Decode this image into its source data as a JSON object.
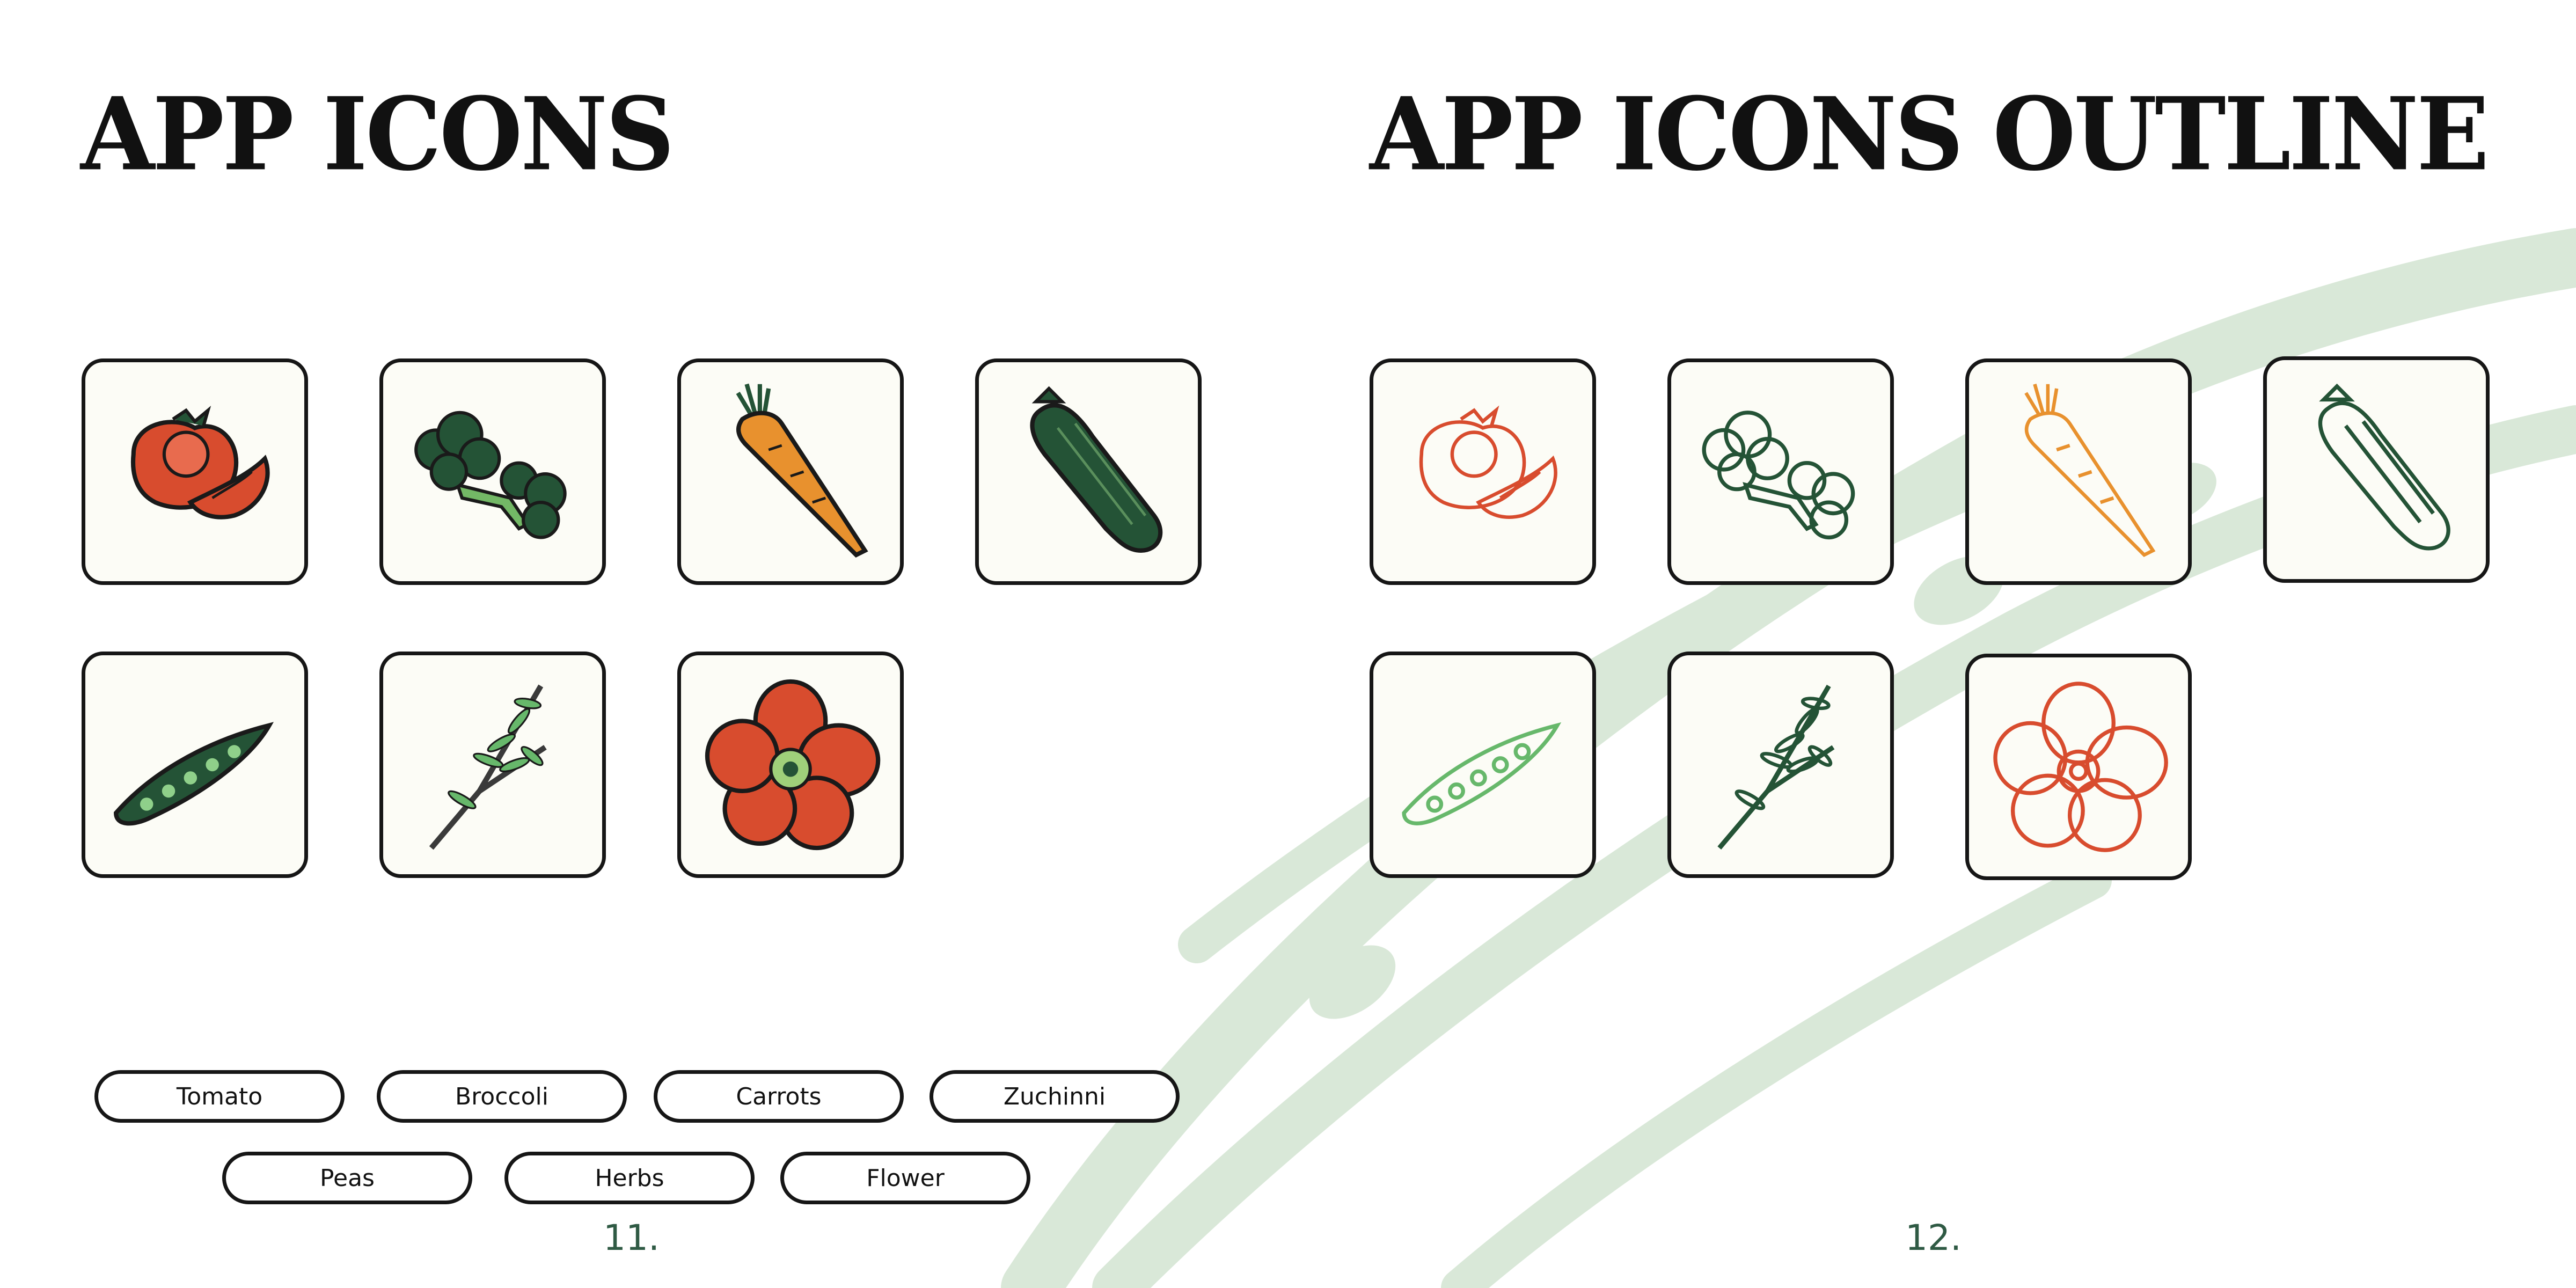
{
  "colors": {
    "accent_green": "#2f5a44",
    "background_pod": "#d9e8d8",
    "tile_fill": "#fcfcf6",
    "tomato_red": "#d84c2e",
    "carrot_orange": "#e8912e",
    "dark_green": "#245336",
    "pea_green": "#67b86b"
  },
  "left_panel": {
    "title": "APP ICONS",
    "icons": [
      "tomato-icon",
      "broccoli-icon",
      "carrot-icon",
      "zucchini-icon",
      "peas-icon",
      "herbs-icon",
      "flower-icon"
    ],
    "labels": [
      "Tomato",
      "Broccoli",
      "Carrots",
      "Zuchinni",
      "Peas",
      "Herbs",
      "Flower"
    ],
    "page_number": "11."
  },
  "right_panel": {
    "title": "APP ICONS OUTLINE",
    "icons": [
      "tomato-outline-icon",
      "broccoli-outline-icon",
      "carrot-outline-icon",
      "zucchini-outline-icon",
      "peas-outline-icon",
      "herbs-outline-icon",
      "flower-outline-icon"
    ],
    "page_number": "12."
  }
}
